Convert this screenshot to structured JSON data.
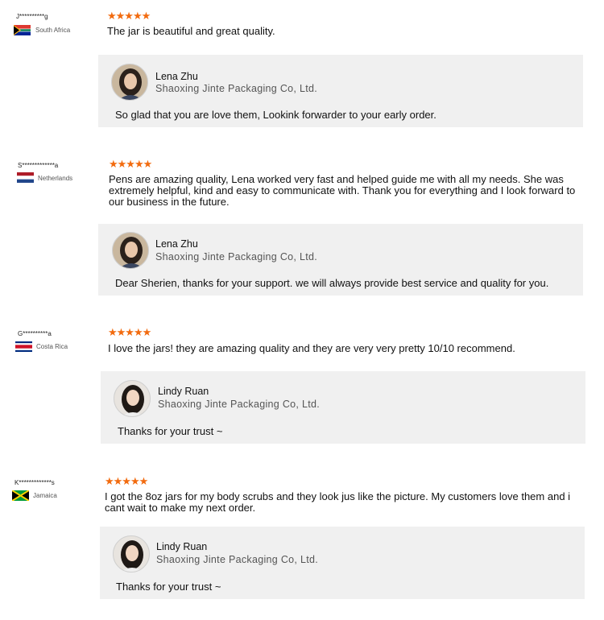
{
  "reviews": [
    {
      "buyer": "J**********g",
      "country": "South Africa",
      "flag_icon": "south-africa-flag-icon",
      "rating": 5,
      "stars": "★★★★★",
      "comment": "The jar is beautiful and great quality.",
      "reply": {
        "name": "Lena Zhu",
        "company": "Shaoxing Jinte Packaging Co, Ltd.",
        "text": "So glad that you are love them, Lookink forwarder to your early order."
      }
    },
    {
      "buyer": "S*************a",
      "country": "Netherlands",
      "flag_icon": "netherlands-flag-icon",
      "rating": 5,
      "stars": "★★★★★",
      "comment": "Pens are amazing quality, Lena worked very fast and helped guide me with all my needs. She was extremely helpful, kind and easy to communicate with. Thank you for everything and I look forward to our business in the future.",
      "reply": {
        "name": "Lena Zhu",
        "company": "Shaoxing Jinte Packaging Co, Ltd.",
        "text": "Dear Sherien, thanks for your support. we will always provide best service and quality for you."
      }
    },
    {
      "buyer": "G**********a",
      "country": "Costa Rica",
      "flag_icon": "costa-rica-flag-icon",
      "rating": 5,
      "stars": "★★★★★",
      "comment": "I love the jars! they are amazing quality and they are very very pretty 10/10 recommend.",
      "reply": {
        "name": "Lindy Ruan",
        "company": "Shaoxing Jinte Packaging Co, Ltd.",
        "text": "Thanks for your trust ~"
      }
    },
    {
      "buyer": "K*************s",
      "country": "Jamaica",
      "flag_icon": "jamaica-flag-icon",
      "rating": 5,
      "stars": "★★★★★",
      "comment": "I got the 8oz jars for my body scrubs and they look jus like the picture. My customers love them and i cant wait to make my next order.",
      "reply": {
        "name": "Lindy Ruan",
        "company": "Shaoxing Jinte Packaging Co, Ltd.",
        "text": "Thanks for your trust ~"
      }
    }
  ],
  "colors": {
    "star": "#f26b0f",
    "reply_background": "#f0f0f0"
  }
}
